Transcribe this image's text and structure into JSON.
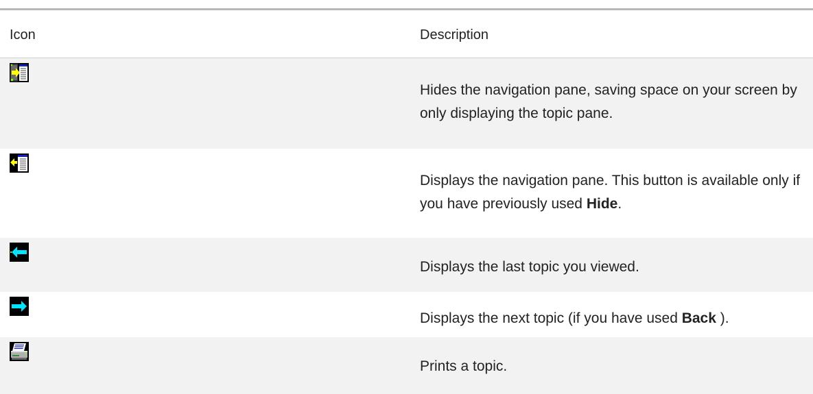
{
  "table": {
    "headers": {
      "icon": "Icon",
      "description": "Description"
    },
    "rows": [
      {
        "icon": "hide-icon",
        "parts": [
          {
            "text": "Hides the navigation pane, saving space on your screen by only displaying the topic pane."
          }
        ]
      },
      {
        "icon": "show-icon",
        "parts": [
          {
            "text": "Displays the navigation pane.  This button is available only if you have previously used "
          },
          {
            "text": "Hide",
            "bold": true
          },
          {
            "text": "."
          }
        ]
      },
      {
        "icon": "back-icon",
        "parts": [
          {
            "text": "Displays the last topic you viewed."
          }
        ]
      },
      {
        "icon": "forward-icon",
        "parts": [
          {
            "text": "Displays the next topic (if you have used "
          },
          {
            "text": "Back",
            "bold": true
          },
          {
            "text": " )."
          }
        ]
      },
      {
        "icon": "print-icon",
        "parts": [
          {
            "text": "Prints a topic."
          }
        ]
      }
    ]
  },
  "colors": {
    "row_shade": "#f2f2f2",
    "rule": "#b7b7b7",
    "cyan_arrow": "#00e5ff",
    "yellow_arrow": "#ffff00"
  }
}
